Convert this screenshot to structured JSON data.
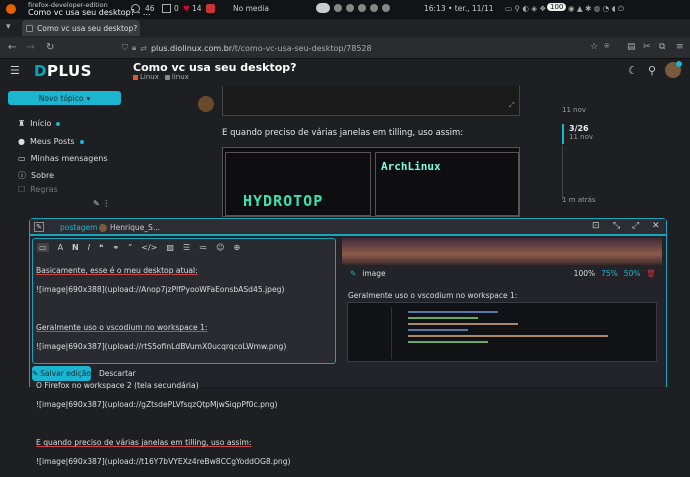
{
  "system": {
    "app_name": "firefox-developer-edition",
    "window_title": "Como vc usa seu desktop? - ...",
    "stat1": "46",
    "stat2": "0",
    "stat3": "14",
    "media": "No media",
    "clock": "16:13 • ter., 11/11",
    "battery": "100"
  },
  "browser": {
    "tab_title": "Como vc usa seu desktop?",
    "url_host": "plus.diolinux.com.br",
    "url_path": "/t/como-vc-usa-seu-desktop/78528"
  },
  "site": {
    "logo_d": "D",
    "logo_plus": "PLUS",
    "topic_title": "Como vc usa seu desktop?",
    "categories": [
      {
        "label": "Linux",
        "color": "#e45735"
      },
      {
        "label": "linux",
        "color": ""
      }
    ]
  },
  "sidebar": {
    "new_topic": "Novo tópico",
    "items": [
      {
        "label": "Início",
        "dot": true
      },
      {
        "label": "Meus Posts",
        "dot": true
      },
      {
        "label": "Minhas mensagens",
        "dot": false
      },
      {
        "label": "Sobre",
        "dot": false
      },
      {
        "label": "Regras",
        "dot": false
      }
    ]
  },
  "post": {
    "text": "E quando preciso de várias janelas em tilling, uso assim:",
    "screenshot_text": "HYDROTOP",
    "screenshot_text2": "ArchLinux"
  },
  "timeline": {
    "date_top": "11 nov",
    "position": "3/26",
    "position_date": "11 nov",
    "last": "1 m atrás"
  },
  "composer": {
    "reply_to": "postagem 3",
    "user": "Henrique_S...",
    "lines": [
      "Basicamente, esse é o meu desktop atual:",
      "![image|690x388](upload://Anop7jzPlfPyooWFaEonsbASd45.jpeg)",
      "",
      "Geralmente uso o vscodium no workspace 1:",
      "![image|690x387](upload://rtS5ofinLdBVumX0ucqrqcoLWmw.png)",
      "",
      "O Firefox no workspace 2 (tela secundária)",
      "![image|690x387](upload://gZtsdePLVfsqzQtpMjwSiqpPf0c.png)",
      "",
      "E quando preciso de várias janelas em tilling, uso assim:",
      "![image|690x387](upload://t16Y7bVYEXz4reBw8CCgYoddOG8.png)"
    ],
    "preview_image_label": "image",
    "zoom_options": [
      "100%",
      "75%",
      "50%"
    ],
    "preview_text": "Geralmente uso o vscodium no workspace 1:",
    "save_label": "Salvar edição",
    "cancel_label": "Descartar"
  }
}
